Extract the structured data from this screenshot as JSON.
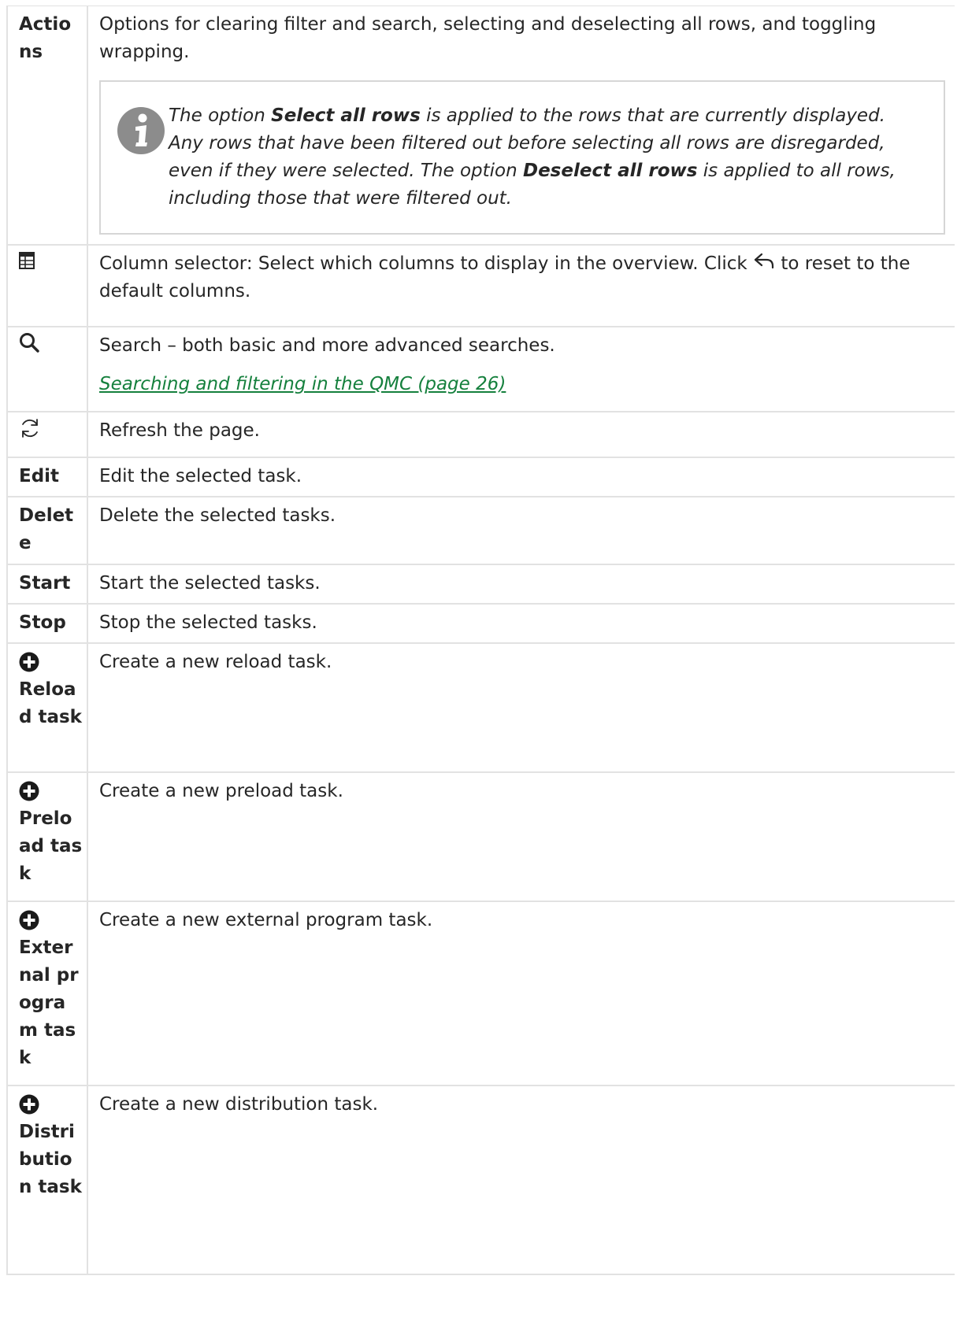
{
  "rows": [
    {
      "name": "Actions",
      "description": "Options for clearing filter and search, selecting and deselecting all rows, and toggling wrapping.",
      "note": {
        "icon": "info-icon",
        "part1": "The option ",
        "bold1": "Select all rows",
        "part2": " is applied to the rows that are currently displayed. Any rows that have been filtered out before selecting all rows are disregarded, even if they were selected. The option ",
        "bold2": "Deselect all rows",
        "part3": " is applied to all rows, including those that were filtered out."
      }
    },
    {
      "icon": "column-selector-icon",
      "description_before": "Column selector: Select which columns to display in the overview. Click ",
      "inline_icon": "undo-arrow-icon",
      "description_after": " to reset to the default columns."
    },
    {
      "icon": "search-icon",
      "description": "Search – both basic and more advanced searches.",
      "link": " Searching and filtering in the QMC (page 26)"
    },
    {
      "icon": "refresh-icon",
      "description": "Refresh the page."
    },
    {
      "name": "Edit",
      "description": "Edit the selected task."
    },
    {
      "name": "Delete",
      "description": "Delete the selected tasks."
    },
    {
      "name": "Start",
      "description": "Start the selected tasks."
    },
    {
      "name": "Stop",
      "description": "Stop the selected tasks."
    },
    {
      "icon": "plus-circle-icon",
      "name": "Reload task",
      "description": "Create a new reload task."
    },
    {
      "icon": "plus-circle-icon",
      "name": "Preload task",
      "description": "Create a new preload task."
    },
    {
      "icon": "plus-circle-icon",
      "name": "External program task",
      "description": "Create a new external program task."
    },
    {
      "icon": "plus-circle-icon",
      "name": "Distribution task",
      "description": "Create a new distribution task."
    }
  ],
  "colors": {
    "link": "#15803d",
    "border": "#e2e2e2",
    "note_icon": "#8c8c8c",
    "text": "#262626"
  }
}
